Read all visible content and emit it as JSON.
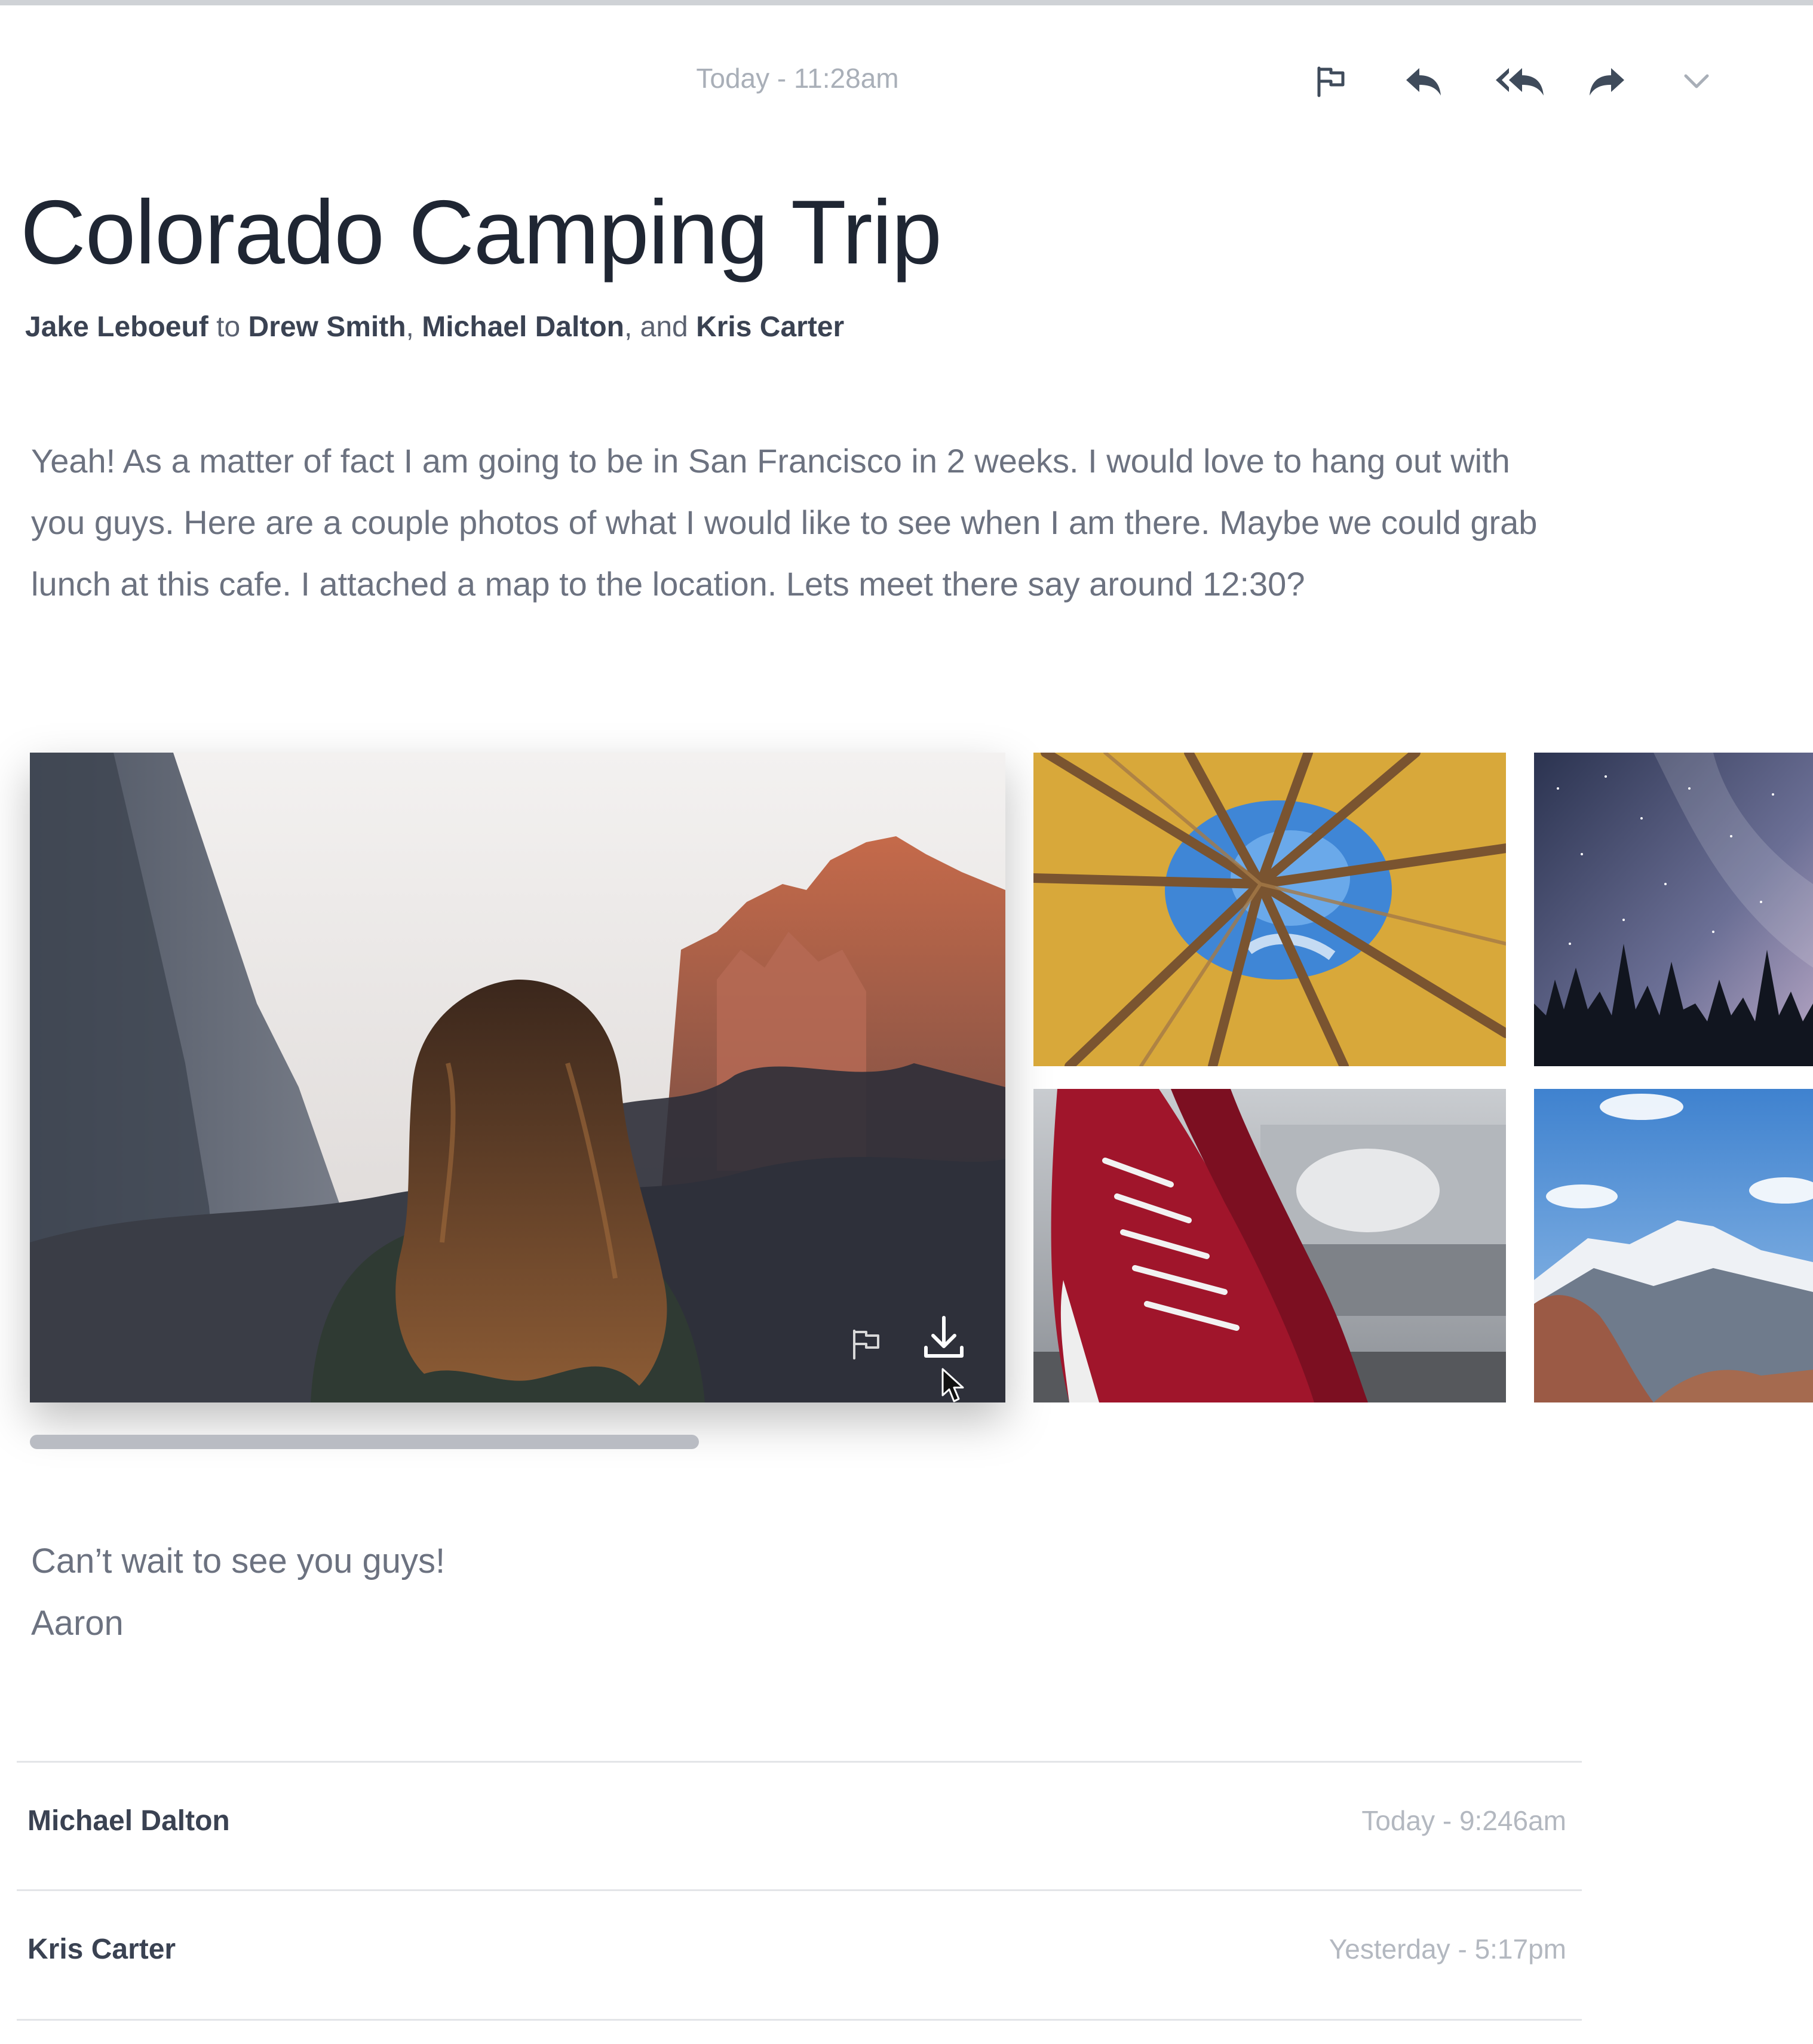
{
  "header": {
    "timestamp": "Today - 11:28am"
  },
  "toolbar": {
    "icons": [
      "flag-icon",
      "reply-icon",
      "reply-all-icon",
      "forward-icon",
      "chevron-down-icon"
    ],
    "icon_color": "#3f4b5b"
  },
  "message": {
    "title": "Colorado Camping Trip",
    "sender": "Jake Leboeuf",
    "to_word": "to",
    "recipient_1": "Drew Smith",
    "separator": ",",
    "recipient_2": "Michael Dalton",
    "and_word": ", and",
    "recipient_3": "Kris Carter",
    "body": "Yeah! As a matter of fact I am going to be in San Francisco in 2 weeks. I would love to hang out with you guys. Here are a couple photos of what I would like to see when I am there. Maybe we could grab lunch at this cafe. I attached a map to the location. Lets meet there say around 12:30?",
    "signoff_line": "Can’t wait to see you guys!",
    "signature": "Aaron"
  },
  "attachments": {
    "images": [
      "woman-in-canyon-photo",
      "teepee-sky-photo",
      "starry-night-photo",
      "red-sneakers-photo",
      "snowy-mountain-photo"
    ],
    "overlay_icons": [
      "flag-icon",
      "download-icon"
    ],
    "scroll_fraction": 0.31
  },
  "thread": [
    {
      "name": "Michael Dalton",
      "time": "Today - 9:246am"
    },
    {
      "name": "Kris Carter",
      "time": "Yesterday - 5:17pm"
    }
  ]
}
